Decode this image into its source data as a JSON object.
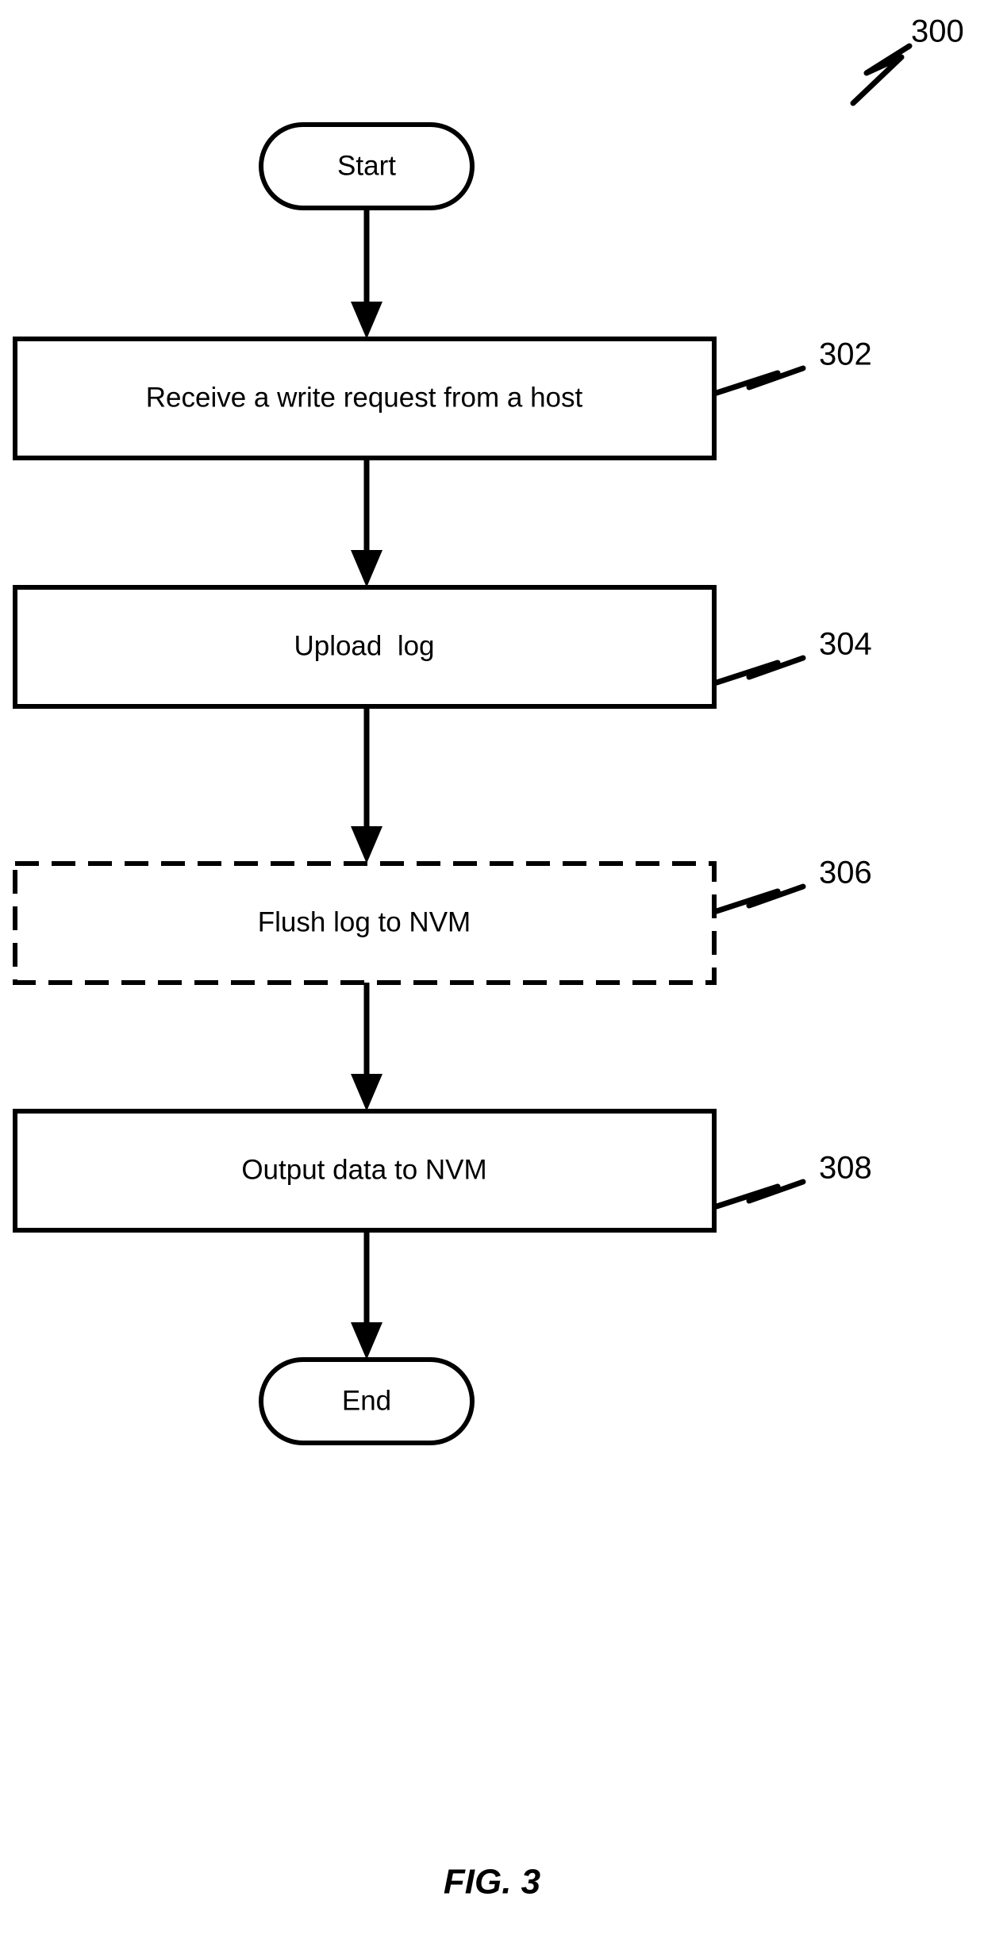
{
  "figure": {
    "caption": "FIG. 3",
    "diagram_reference": "300",
    "diagram_type": "flowchart"
  },
  "nodes": [
    {
      "id": "start",
      "shape": "terminal",
      "label": "Start",
      "reference": ""
    },
    {
      "id": "step-302",
      "shape": "process",
      "label": "Receive a write request from a host",
      "reference": "302"
    },
    {
      "id": "step-304",
      "shape": "process",
      "label": "Upload  log",
      "reference": "304"
    },
    {
      "id": "step-306",
      "shape": "process-optional",
      "label": "Flush log to NVM",
      "reference": "306"
    },
    {
      "id": "step-308",
      "shape": "process",
      "label": "Output data to NVM",
      "reference": "308"
    },
    {
      "id": "end",
      "shape": "terminal",
      "label": "End",
      "reference": ""
    }
  ],
  "edges": [
    {
      "from": "start",
      "to": "step-302"
    },
    {
      "from": "step-302",
      "to": "step-304"
    },
    {
      "from": "step-304",
      "to": "step-306"
    },
    {
      "from": "step-306",
      "to": "step-308"
    },
    {
      "from": "step-308",
      "to": "end"
    }
  ],
  "colors": {
    "stroke": "#000000",
    "fill": "#ffffff",
    "background": "#ffffff"
  }
}
